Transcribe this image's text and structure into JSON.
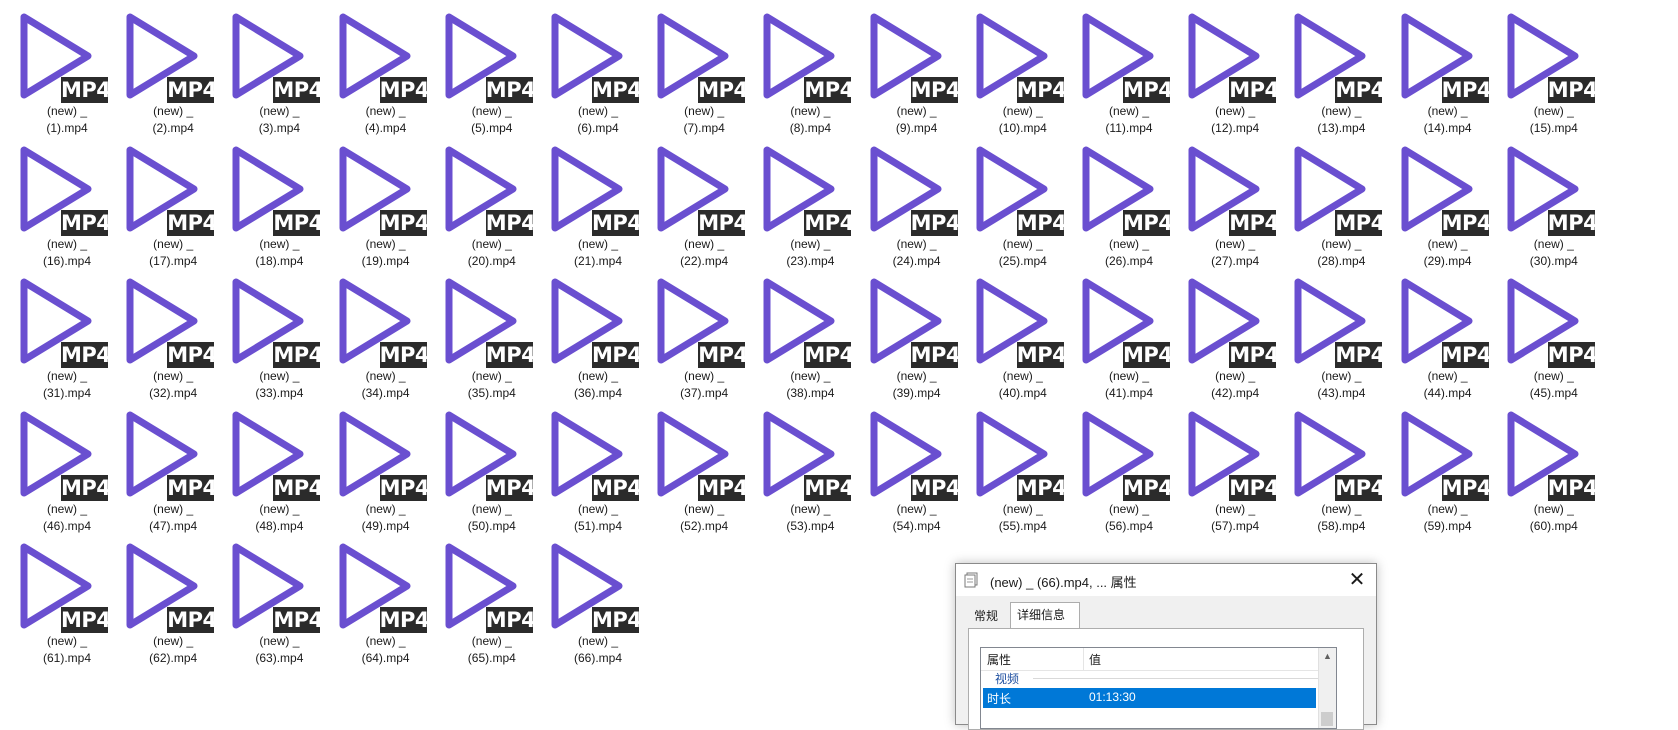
{
  "files": [
    {
      "line1": "(new) _",
      "line2": "(1).mp4"
    },
    {
      "line1": "(new) _",
      "line2": "(2).mp4"
    },
    {
      "line1": "(new) _",
      "line2": "(3).mp4"
    },
    {
      "line1": "(new) _",
      "line2": "(4).mp4"
    },
    {
      "line1": "(new) _",
      "line2": "(5).mp4"
    },
    {
      "line1": "(new) _",
      "line2": "(6).mp4"
    },
    {
      "line1": "(new) _",
      "line2": "(7).mp4"
    },
    {
      "line1": "(new) _",
      "line2": "(8).mp4"
    },
    {
      "line1": "(new) _",
      "line2": "(9).mp4"
    },
    {
      "line1": "(new) _",
      "line2": "(10).mp4"
    },
    {
      "line1": "(new) _",
      "line2": "(11).mp4"
    },
    {
      "line1": "(new) _",
      "line2": "(12).mp4"
    },
    {
      "line1": "(new) _",
      "line2": "(13).mp4"
    },
    {
      "line1": "(new) _",
      "line2": "(14).mp4"
    },
    {
      "line1": "(new) _",
      "line2": "(15).mp4"
    },
    {
      "line1": "(new) _",
      "line2": "(16).mp4"
    },
    {
      "line1": "(new) _",
      "line2": "(17).mp4"
    },
    {
      "line1": "(new) _",
      "line2": "(18).mp4"
    },
    {
      "line1": "(new) _",
      "line2": "(19).mp4"
    },
    {
      "line1": "(new) _",
      "line2": "(20).mp4"
    },
    {
      "line1": "(new) _",
      "line2": "(21).mp4"
    },
    {
      "line1": "(new) _",
      "line2": "(22).mp4"
    },
    {
      "line1": "(new) _",
      "line2": "(23).mp4"
    },
    {
      "line1": "(new) _",
      "line2": "(24).mp4"
    },
    {
      "line1": "(new) _",
      "line2": "(25).mp4"
    },
    {
      "line1": "(new) _",
      "line2": "(26).mp4"
    },
    {
      "line1": "(new) _",
      "line2": "(27).mp4"
    },
    {
      "line1": "(new) _",
      "line2": "(28).mp4"
    },
    {
      "line1": "(new) _",
      "line2": "(29).mp4"
    },
    {
      "line1": "(new) _",
      "line2": "(30).mp4"
    },
    {
      "line1": "(new) _",
      "line2": "(31).mp4"
    },
    {
      "line1": "(new) _",
      "line2": "(32).mp4"
    },
    {
      "line1": "(new) _",
      "line2": "(33).mp4"
    },
    {
      "line1": "(new) _",
      "line2": "(34).mp4"
    },
    {
      "line1": "(new) _",
      "line2": "(35).mp4"
    },
    {
      "line1": "(new) _",
      "line2": "(36).mp4"
    },
    {
      "line1": "(new) _",
      "line2": "(37).mp4"
    },
    {
      "line1": "(new) _",
      "line2": "(38).mp4"
    },
    {
      "line1": "(new) _",
      "line2": "(39).mp4"
    },
    {
      "line1": "(new) _",
      "line2": "(40).mp4"
    },
    {
      "line1": "(new) _",
      "line2": "(41).mp4"
    },
    {
      "line1": "(new) _",
      "line2": "(42).mp4"
    },
    {
      "line1": "(new) _",
      "line2": "(43).mp4"
    },
    {
      "line1": "(new) _",
      "line2": "(44).mp4"
    },
    {
      "line1": "(new) _",
      "line2": "(45).mp4"
    },
    {
      "line1": "(new) _",
      "line2": "(46).mp4"
    },
    {
      "line1": "(new) _",
      "line2": "(47).mp4"
    },
    {
      "line1": "(new) _",
      "line2": "(48).mp4"
    },
    {
      "line1": "(new) _",
      "line2": "(49).mp4"
    },
    {
      "line1": "(new) _",
      "line2": "(50).mp4"
    },
    {
      "line1": "(new) _",
      "line2": "(51).mp4"
    },
    {
      "line1": "(new) _",
      "line2": "(52).mp4"
    },
    {
      "line1": "(new) _",
      "line2": "(53).mp4"
    },
    {
      "line1": "(new) _",
      "line2": "(54).mp4"
    },
    {
      "line1": "(new) _",
      "line2": "(55).mp4"
    },
    {
      "line1": "(new) _",
      "line2": "(56).mp4"
    },
    {
      "line1": "(new) _",
      "line2": "(57).mp4"
    },
    {
      "line1": "(new) _",
      "line2": "(58).mp4"
    },
    {
      "line1": "(new) _",
      "line2": "(59).mp4"
    },
    {
      "line1": "(new) _",
      "line2": "(60).mp4"
    },
    {
      "line1": "(new) _",
      "line2": "(61).mp4"
    },
    {
      "line1": "(new) _",
      "line2": "(62).mp4"
    },
    {
      "line1": "(new) _",
      "line2": "(63).mp4"
    },
    {
      "line1": "(new) _",
      "line2": "(64).mp4"
    },
    {
      "line1": "(new) _",
      "line2": "(65).mp4"
    },
    {
      "line1": "(new) _",
      "line2": "(66).mp4"
    }
  ],
  "file_icon": {
    "name": "mp4-video-icon",
    "badge_text": "MP4",
    "play_color": "#6a4fd0",
    "badge_color": "#2b2b2b"
  },
  "dialog": {
    "title": "(new) _ (66).mp4, ... 属性",
    "close_glyph": "✕",
    "tabs": [
      "常规",
      "详细信息"
    ],
    "active_tab": "详细信息",
    "columns": {
      "property": "属性",
      "value": "值"
    },
    "group": "视频",
    "selected_row": {
      "property": "时长",
      "value": "01:13:30"
    },
    "selection_color": "#0078d7"
  }
}
